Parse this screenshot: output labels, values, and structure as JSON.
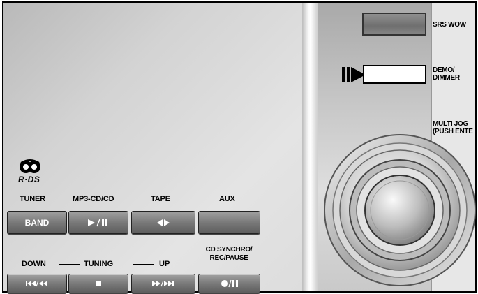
{
  "right_panel": {
    "srs_label": "SRS WOW",
    "demo_label": "DEMO/\nDIMMER",
    "multi_jog_label": "MULTI JOG\n(PUSH ENTE"
  },
  "logo": {
    "text": "R·DS",
    "icon": "rds-logo-icon"
  },
  "function_row": {
    "labels": [
      "TUNER",
      "MP3-CD/CD",
      "TAPE",
      "AUX"
    ],
    "buttons": [
      {
        "label": "BAND",
        "icon": null
      },
      {
        "label": "",
        "icon": "play-pause-icon"
      },
      {
        "label": "",
        "icon": "tape-direction-icon"
      },
      {
        "label": "",
        "icon": null
      }
    ]
  },
  "tuning_row": {
    "down": "DOWN",
    "tuning": "TUNING",
    "up": "UP",
    "cd_synchro": "CD SYNCHRO/\nREC/PAUSE",
    "buttons": [
      {
        "icon": "skip-back-rewind-icon"
      },
      {
        "icon": "stop-icon"
      },
      {
        "icon": "fast-forward-skip-icon"
      },
      {
        "icon": "record-pause-icon"
      }
    ]
  },
  "colors": {
    "button_dark": "#6a6a6a",
    "panel_light": "#e7e7e7",
    "outline": "#000000"
  }
}
